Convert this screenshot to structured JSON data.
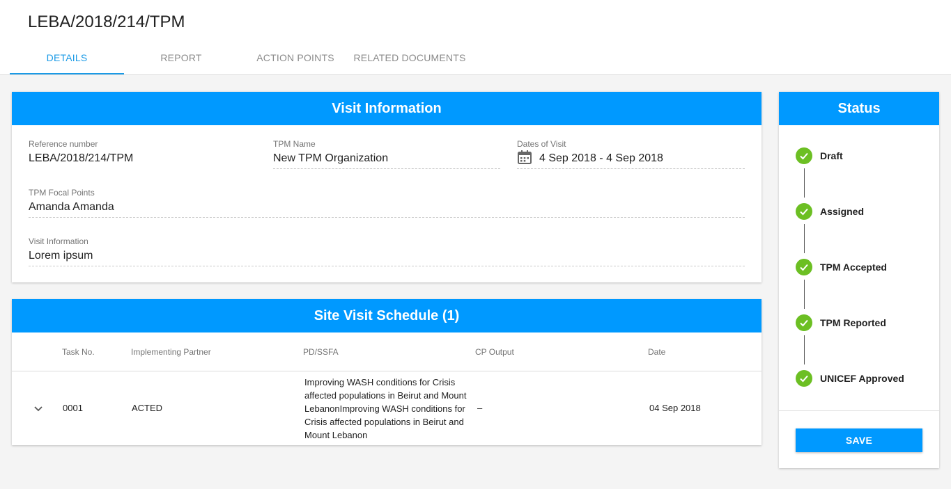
{
  "page": {
    "title": "LEBA/2018/214/TPM"
  },
  "tabs": [
    {
      "label": "DETAILS",
      "active": true
    },
    {
      "label": "REPORT",
      "active": false
    },
    {
      "label": "ACTION POINTS",
      "active": false
    },
    {
      "label": "RELATED DOCUMENTS",
      "active": false
    }
  ],
  "visit_info": {
    "title": "Visit Information",
    "fields": {
      "reference": {
        "label": "Reference number",
        "value": "LEBA/2018/214/TPM"
      },
      "tpm_name": {
        "label": "TPM Name",
        "value": "New TPM Organization"
      },
      "dates": {
        "label": "Dates of Visit",
        "value": "4 Sep 2018 - 4 Sep 2018",
        "icon": "calendar-icon"
      },
      "focal_points": {
        "label": "TPM Focal Points",
        "value": "Amanda Amanda"
      },
      "visit_information": {
        "label": "Visit Information",
        "value": "Lorem ipsum"
      }
    }
  },
  "schedule": {
    "title": "Site Visit Schedule (1)",
    "columns": [
      "Task No.",
      "Implementing Partner",
      "PD/SSFA",
      "CP Output",
      "Date"
    ],
    "rows": [
      {
        "task_no": "0001",
        "partner": "ACTED",
        "pd_ssfa_lines": [
          "Improving WASH conditions for Crisis",
          "affected populations in Beirut and Mount",
          "LebanonImproving WASH conditions for",
          "Crisis affected populations in Beirut and",
          "Mount Lebanon"
        ],
        "cp_output": "–",
        "date": "04 Sep 2018",
        "expand_icon": "chevron-down-icon"
      }
    ]
  },
  "status": {
    "title": "Status",
    "steps": [
      {
        "label": "Draft",
        "done": true
      },
      {
        "label": "Assigned",
        "done": true
      },
      {
        "label": "TPM Accepted",
        "done": true
      },
      {
        "label": "TPM Reported",
        "done": true
      },
      {
        "label": "UNICEF Approved",
        "done": true
      }
    ],
    "save_label": "SAVE"
  },
  "colors": {
    "accent": "#0099ff",
    "tab_active": "#1a9ae6",
    "status_done": "#6cbf23"
  }
}
